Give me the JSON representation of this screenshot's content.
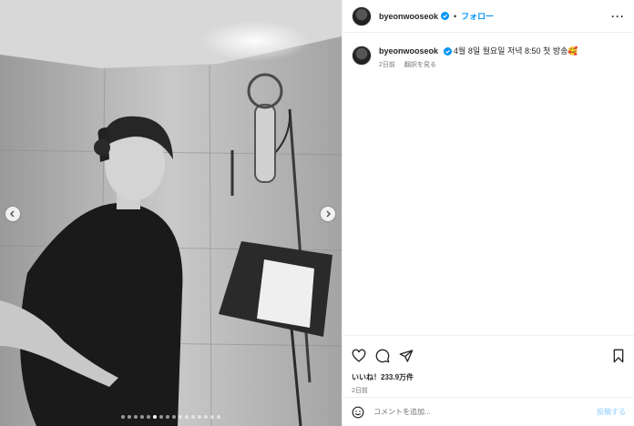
{
  "post": {
    "username": "byeonwooseok",
    "follow_label": "フォロー",
    "separator": "•",
    "more_label": "···",
    "caption_username": "byeonwooseok",
    "caption_text": "4월 8일 월요일 저녁 8:50 첫 방송🥰",
    "caption_time": "2日前",
    "translate_label": "翻訳を見る",
    "likes_text": "いいね！233.9万件",
    "posted_ago": "2日前",
    "comment_placeholder": "コメントを追加...",
    "post_label": "投稿する"
  },
  "carousel": {
    "dot_count": 16,
    "active_index": 5
  },
  "colors": {
    "accent": "#0095f6",
    "post_disabled": "#b2dffc",
    "muted": "#737373"
  }
}
